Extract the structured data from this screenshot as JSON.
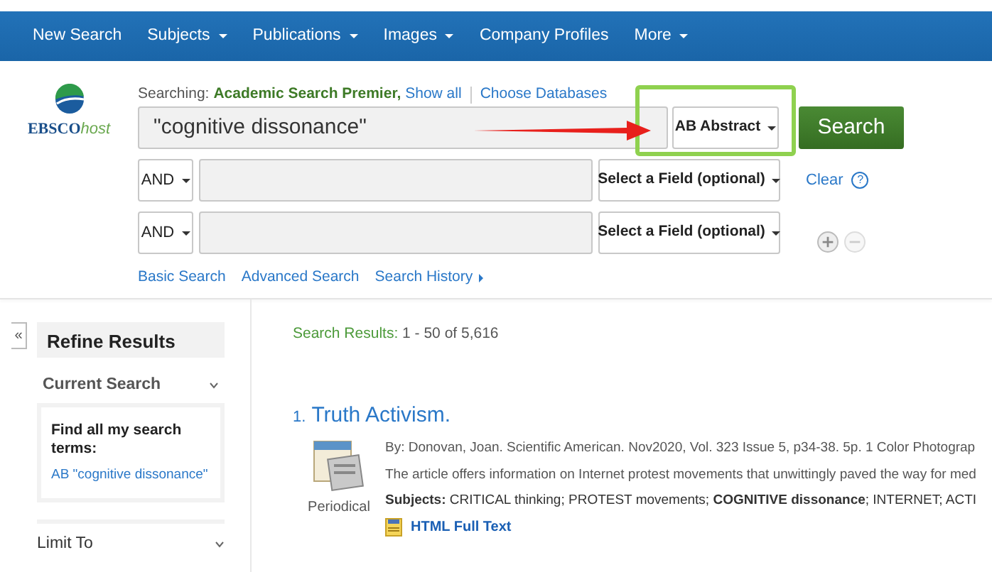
{
  "nav": {
    "items": [
      {
        "label": "New Search",
        "dropdown": false
      },
      {
        "label": "Subjects",
        "dropdown": true
      },
      {
        "label": "Publications",
        "dropdown": true
      },
      {
        "label": "Images",
        "dropdown": true
      },
      {
        "label": "Company Profiles",
        "dropdown": false
      },
      {
        "label": "More",
        "dropdown": true
      }
    ]
  },
  "logo": {
    "brand": "EBSCO",
    "suffix": "host"
  },
  "searching": {
    "label": "Searching:",
    "database": "Academic Search Premier,",
    "show_all": "Show all",
    "choose": "Choose Databases"
  },
  "search_rows": [
    {
      "kind": "main",
      "value": "\"cognitive dissonance\"",
      "field": "AB Abstract",
      "highlighted": true
    },
    {
      "kind": "extra",
      "operator": "AND",
      "value": "",
      "field": "Select a Field (optional)",
      "highlighted": false
    },
    {
      "kind": "extra",
      "operator": "AND",
      "value": "",
      "field": "Select a Field (optional)",
      "highlighted": false
    }
  ],
  "search_button": "Search",
  "clear": {
    "label": "Clear",
    "help": "?"
  },
  "row_controls": {
    "add_disabled": false,
    "remove_disabled": true
  },
  "links": [
    {
      "label": "Basic Search",
      "caret": false
    },
    {
      "label": "Advanced Search",
      "caret": false
    },
    {
      "label": "Search History",
      "caret": true
    }
  ],
  "sidebar": {
    "collapse": "«",
    "title": "Refine Results",
    "sections": [
      {
        "title": "Current Search",
        "heading": "Find all my search terms:",
        "term": "AB \"cognitive dissonance\""
      },
      {
        "title": "Limit To"
      }
    ]
  },
  "results": {
    "label": "Search Results:",
    "count": "1 - 50 of 5,616",
    "items": [
      {
        "number": "1.",
        "title": "Truth Activism.",
        "type": "Periodical",
        "byline": "By: Donovan, Joan. Scientific American. Nov2020, Vol. 323 Issue 5, p34-38. 5p. 1 Color Photograp",
        "abstract": "The article offers information on Internet protest movements that unwittingly paved the way for med",
        "subjects": "**Subjects:** CRITICAL thinking; PROTEST movements; **COGNITIVE dissonance**; INTERNET; ACTI",
        "full_text": "HTML Full Text"
      }
    ]
  }
}
